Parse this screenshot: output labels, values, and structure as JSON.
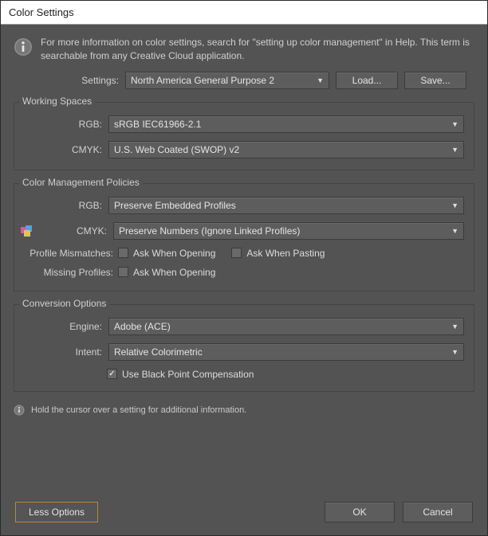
{
  "window": {
    "title": "Color Settings"
  },
  "info": {
    "text": "For more information on color settings, search for \"setting up color management\" in Help. This term is searchable from any Creative Cloud application."
  },
  "settings": {
    "label": "Settings:",
    "value": "North America General Purpose 2",
    "load": "Load...",
    "save": "Save..."
  },
  "workingSpaces": {
    "legend": "Working Spaces",
    "rgbLabel": "RGB:",
    "rgbValue": "sRGB IEC61966-2.1",
    "cmykLabel": "CMYK:",
    "cmykValue": "U.S. Web Coated (SWOP) v2"
  },
  "policies": {
    "legend": "Color Management Policies",
    "rgbLabel": "RGB:",
    "rgbValue": "Preserve Embedded Profiles",
    "cmykLabel": "CMYK:",
    "cmykValue": "Preserve Numbers (Ignore Linked Profiles)",
    "mismatchLabel": "Profile Mismatches:",
    "askOpen": "Ask When Opening",
    "askPaste": "Ask When Pasting",
    "missingLabel": "Missing Profiles:",
    "mismatchOpenChecked": false,
    "mismatchPasteChecked": false,
    "missingOpenChecked": false
  },
  "conversion": {
    "legend": "Conversion Options",
    "engineLabel": "Engine:",
    "engineValue": "Adobe (ACE)",
    "intentLabel": "Intent:",
    "intentValue": "Relative Colorimetric",
    "bpcLabel": "Use Black Point Compensation",
    "bpcChecked": true
  },
  "hint": {
    "text": "Hold the cursor over a setting for additional information."
  },
  "footer": {
    "lessOptions": "Less Options",
    "ok": "OK",
    "cancel": "Cancel"
  }
}
